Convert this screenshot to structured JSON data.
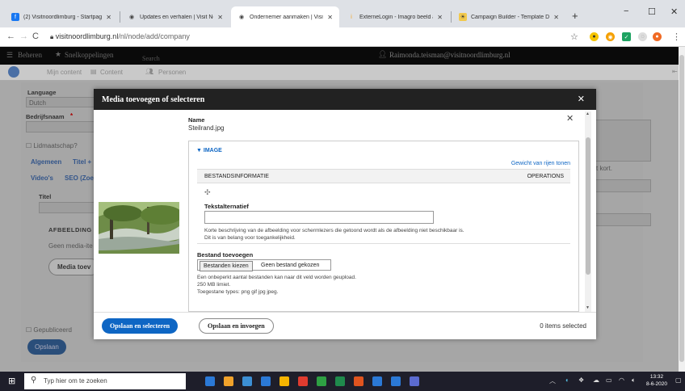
{
  "browser": {
    "tabs": [
      {
        "title": "(2) Visitnoordlimburg - Startpagi",
        "color": "#1877f2",
        "glyph": "f",
        "active": false
      },
      {
        "title": "Updates en verhalen | Visit Noo",
        "color": "#555",
        "glyph": "◉",
        "active": false
      },
      {
        "title": "Ondernemer aanmaken | Visit N",
        "color": "#555",
        "glyph": "◉",
        "active": true
      },
      {
        "title": "ExternеLogin - Imagro beeld ard",
        "color": "#f5a623",
        "glyph": "i",
        "active": false
      },
      {
        "title": "Campaign Builder - Template De",
        "color": "#f2c94c",
        "glyph": "☀",
        "active": false
      }
    ],
    "new_tab": "+",
    "window_controls": {
      "minimize": "−",
      "maximize": "☐",
      "close": "✕"
    },
    "url_domain": "visitnoordlimburg.nl",
    "url_path": "/nl/node/add/company"
  },
  "drupal": {
    "toolbar": {
      "manage": "Beheren",
      "shortcuts": "Snelkoppelingen",
      "search": "Search",
      "user": "Raimonda.teisman@visitnoordlimburg.nl"
    },
    "subbar": {
      "my_content": "Mijn content",
      "content": "Content",
      "people": "Personen"
    }
  },
  "background_form": {
    "language_label": "Language",
    "language_value": "Dutch",
    "company_label": "Bedrijfsnaam",
    "required_mark": "*",
    "membership": "Lidmaatschap?",
    "tab_general": "Algemeen",
    "tab_title": "Titel +",
    "tab_videos": "Video's",
    "tab_seo": "SEO (Zoek",
    "title_label": "Titel",
    "image_heading": "AFBEELDING",
    "no_media": "Geen media-ite",
    "media_button": "Media toev",
    "published": "Gepubliceerd",
    "save": "Opslaan",
    "right_hint": "t kort."
  },
  "modal": {
    "title": "Media toevoegen of selecteren",
    "close": "✕",
    "item_close": "✕",
    "name_label": "Name",
    "name_value": "Steilrand.jpg",
    "image_section": "▼ IMAGE",
    "row_weights": "Gewicht van rijen tonen",
    "col_file_info": "BESTANDSINFORMATIE",
    "col_operations": "OPERATIONS",
    "drag_icon": "✣",
    "alt_label": "Tekstalternatief",
    "alt_value": "",
    "alt_help_1": "Korte beschrijving van de afbeelding voor schermlezers die getoond wordt als de afbeelding niet beschikbaar is.",
    "alt_help_2": "Dit is van belang voor toegankelijkheid.",
    "file_label": "Bestand toevoegen",
    "choose_files": "Bestanden kiezen",
    "no_file": "Geen bestand gekozen",
    "file_help_1": "Een onbeperkt aantal bestanden kan naar dit veld worden geupload.",
    "file_help_2": "250 MB limiet.",
    "file_help_3": "Toegestane types: png gif jpg jpeg.",
    "save_select": "Opslaan en selecteren",
    "save_insert": "Opslaan en invoegen",
    "items_selected": "0 items selected"
  },
  "taskbar": {
    "search_placeholder": "Typ hier om te zoeken",
    "time": "13:32",
    "date": "8-6-2020",
    "app_colors": [
      "#2b79d6",
      "#f0a22b",
      "#3c8fd4",
      "#2b79d6",
      "#f5b400",
      "#e03b2f",
      "#2ea043",
      "#1f8a4c",
      "#e0541f",
      "#2b79d6",
      "#2b79d6",
      "#5b6bd0"
    ]
  }
}
